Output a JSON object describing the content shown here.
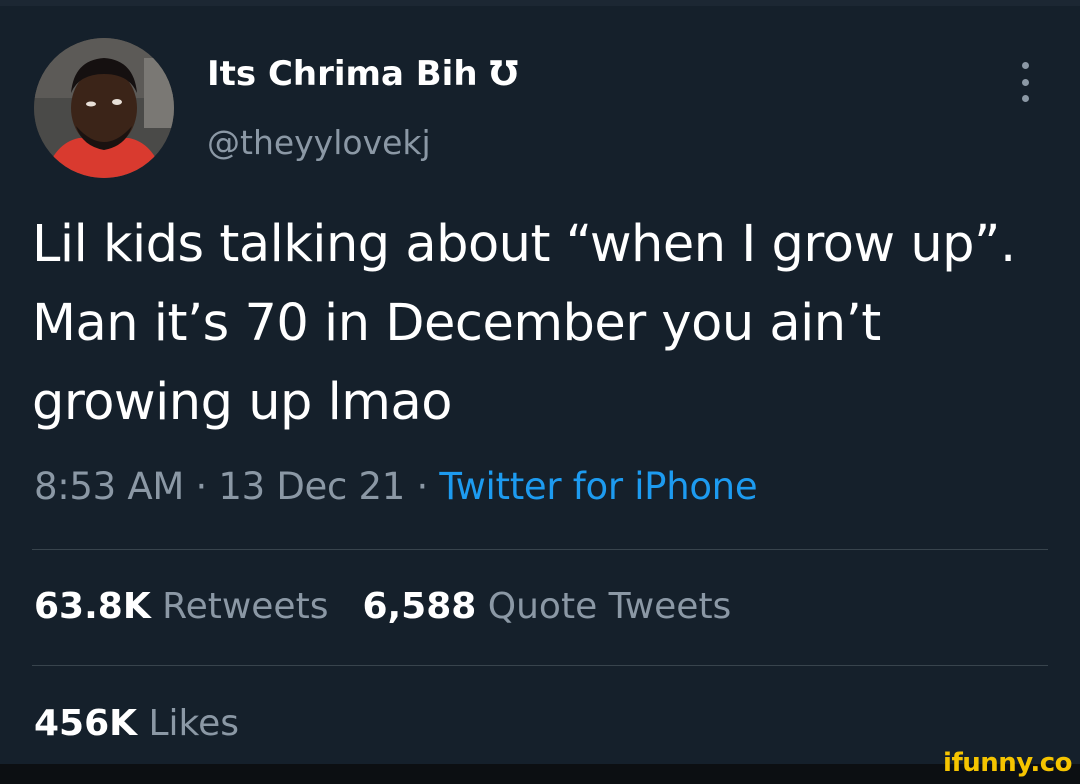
{
  "user": {
    "display_name": "Its Chrima Bih ℧",
    "handle": "@theyylovekj"
  },
  "tweet": {
    "text": "Lil kids talking about “when I grow up”. Man it’s 70 in December you ain’t growing up lmao",
    "time": "8:53 AM",
    "date": "13 Dec 21",
    "separator": "·",
    "source": "Twitter for iPhone"
  },
  "stats": {
    "retweets_count": "63.8K",
    "retweets_label": "Retweets",
    "quotes_count": "6,588",
    "quotes_label": "Quote Tweets",
    "likes_count": "456K",
    "likes_label": "Likes"
  },
  "icons": {
    "more": "more-vertical-icon"
  },
  "watermark": "ifunny.co",
  "colors": {
    "background": "#15202b",
    "muted": "#8b98a5",
    "link": "#1d9bf0",
    "divider": "#38444d",
    "watermark": "#f5c400"
  }
}
